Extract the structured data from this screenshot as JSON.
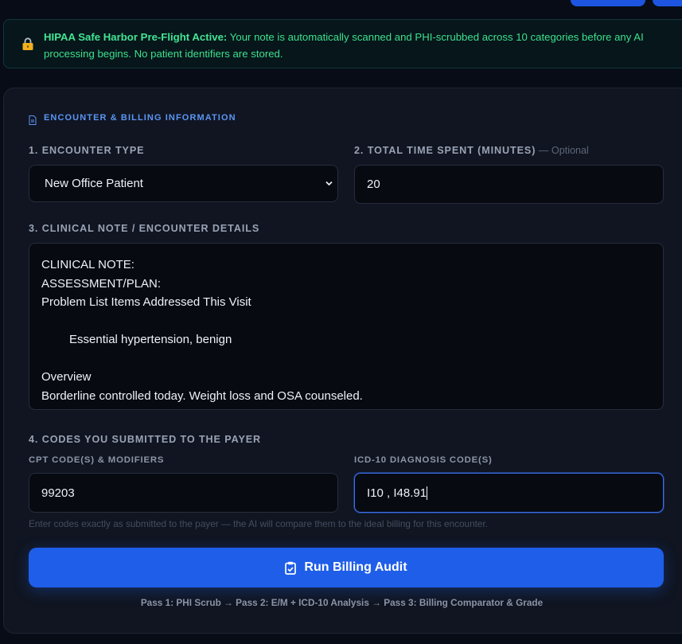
{
  "banner": {
    "title": "HIPAA Safe Harbor Pre-Flight Active:",
    "text": " Your note is automatically scanned and PHI-scrubbed across 10 categories before any AI processing begins. No patient identifiers are stored.",
    "icon": "lock-icon"
  },
  "section": {
    "title": "ENCOUNTER & BILLING INFORMATION"
  },
  "encounter_type": {
    "label": "1. ENCOUNTER TYPE",
    "value": "New Office Patient"
  },
  "total_time": {
    "label": "2. TOTAL TIME SPENT (MINUTES)",
    "optional": " — Optional",
    "value": "20"
  },
  "clinical_note": {
    "label": "3. CLINICAL NOTE / ENCOUNTER DETAILS",
    "lines": [
      "CLINICAL NOTE:",
      "ASSESSMENT/PLAN:",
      "Problem List Items Addressed This Visit",
      "",
      "Essential hypertension, benign",
      "",
      "Overview",
      "Borderline controlled today. Weight loss and OSA counseled."
    ]
  },
  "codes": {
    "label": "4. CODES YOU SUBMITTED TO THE PAYER",
    "cpt_label": "CPT CODE(S) & MODIFIERS",
    "cpt_value": "99203",
    "icd_label": "ICD-10 DIAGNOSIS CODE(S)",
    "icd_value": "I10 , I48.91",
    "hint": "Enter codes exactly as submitted to the payer — the AI will compare them to the ideal billing for this encounter."
  },
  "run_button": {
    "label": "Run Billing Audit"
  },
  "pipeline": "Pass 1: PHI Scrub → Pass 2: E/M + ICD-10 Analysis → Pass 3: Billing Comparator & Grade",
  "colors": {
    "accent": "#1f5ee8",
    "banner_text": "#3ee08e",
    "section_title": "#5b95f4"
  }
}
